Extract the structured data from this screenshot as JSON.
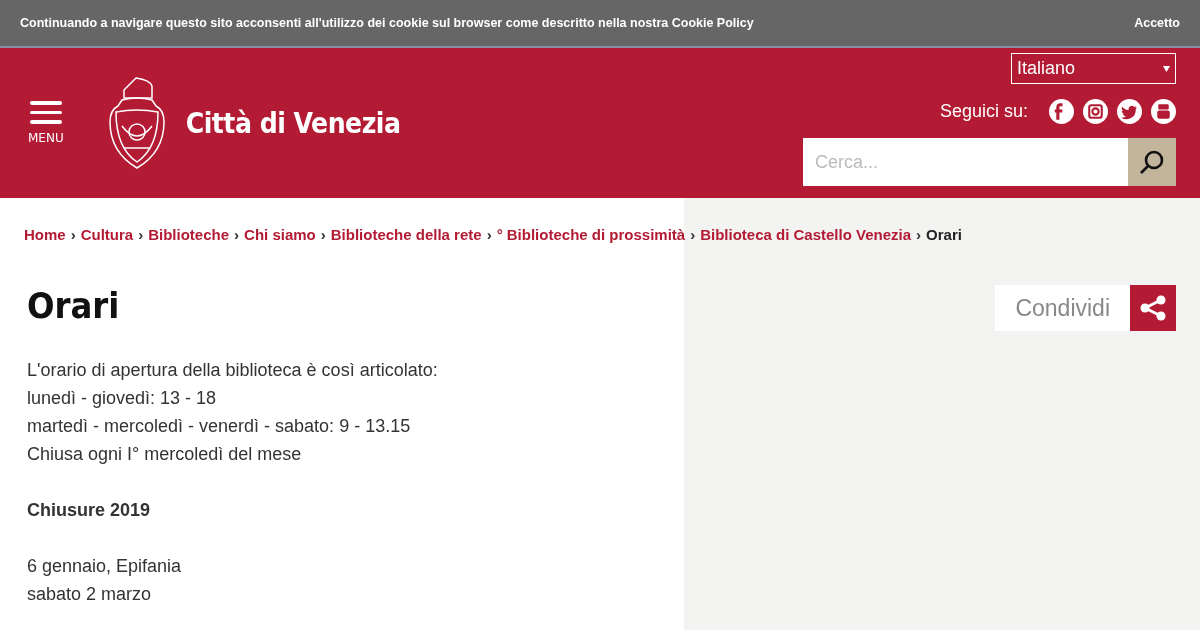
{
  "cookie_bar": {
    "message": "Continuando a navigare questo sito acconsenti all'utilizzo dei cookie sul browser come descritto nella nostra Cookie Policy",
    "accept": "Accetto"
  },
  "header": {
    "menu_label": "MENU",
    "site_title": "Città di Venezia",
    "language": "Italiano",
    "follow_label": "Seguici su:",
    "search": {
      "placeholder": "Cerca..."
    }
  },
  "breadcrumb": [
    {
      "kind": "link",
      "text": "Home"
    },
    {
      "kind": "separator",
      "text": "›"
    },
    {
      "kind": "link",
      "text": "Cultura"
    },
    {
      "kind": "separator",
      "text": "›"
    },
    {
      "kind": "link",
      "text": "Biblioteche"
    },
    {
      "kind": "separator",
      "text": "›"
    },
    {
      "kind": "link",
      "text": "Chi siamo"
    },
    {
      "kind": "separator",
      "text": "›"
    },
    {
      "kind": "link",
      "text": "Biblioteche della rete"
    },
    {
      "kind": "separator",
      "text": "›"
    },
    {
      "kind": "link",
      "text": "° Biblioteche di prossimità"
    },
    {
      "kind": "separator",
      "text": "›"
    },
    {
      "kind": "link",
      "text": "Biblioteca di Castello Venezia"
    },
    {
      "kind": "separator",
      "text": "›"
    },
    {
      "kind": "current",
      "text": "Orari"
    }
  ],
  "page_title": "Orari",
  "share_label": "Condividi",
  "content": [
    {
      "kind": "text",
      "lines": [
        "L'orario di apertura della biblioteca è così articolato:",
        "lunedì - giovedì: 13 - 18",
        "martedì - mercoledì - venerdì - sabato: 9 - 13.15",
        "Chiusa ogni I° mercoledì del mese"
      ]
    },
    {
      "kind": "heading",
      "lines": [
        "Chiusure 2019"
      ]
    },
    {
      "kind": "text",
      "lines": [
        "6 gennaio, Epifania",
        "sabato 2 marzo"
      ]
    }
  ]
}
